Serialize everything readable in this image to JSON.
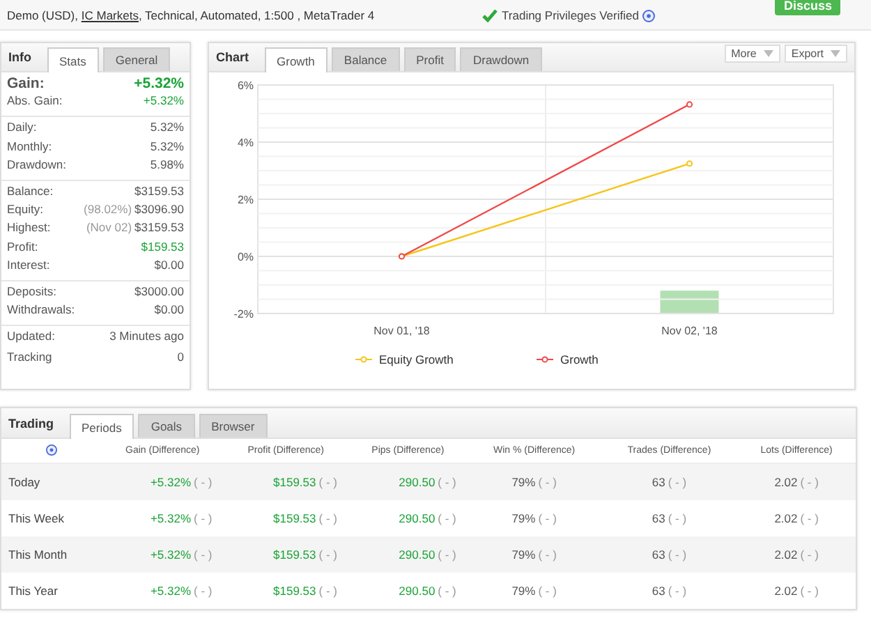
{
  "header": {
    "subtitle_parts": [
      {
        "text": "Demo (USD), ",
        "link": false
      },
      {
        "text": "IC Markets",
        "link": true
      },
      {
        "text": ", Technical, Automated, 1:500 , MetaTrader 4",
        "link": false
      }
    ],
    "verified": "Trading Privileges Verified",
    "discuss": "Discuss"
  },
  "info": {
    "title": "Info",
    "tabs": [
      {
        "label": "Stats",
        "selected": true
      },
      {
        "label": "General",
        "selected": false
      }
    ],
    "groups": [
      [
        {
          "label": "Gain:",
          "value": "+5.32%",
          "kind": "big",
          "positive": true
        },
        {
          "label": "Abs. Gain:",
          "value": "+5.32%",
          "kind": "plain",
          "positive": true
        }
      ],
      [
        {
          "label": "Daily:",
          "value": "5.32%",
          "kind": "plain",
          "positive": false
        },
        {
          "label": "Monthly:",
          "value": "5.32%",
          "kind": "plain",
          "positive": false
        },
        {
          "label": "Drawdown:",
          "value": "5.98%",
          "kind": "plain",
          "positive": false
        }
      ],
      [
        {
          "label": "Balance:",
          "value": "$3159.53",
          "kind": "plain",
          "positive": false
        },
        {
          "label": "Equity:",
          "note": "(98.02%)",
          "value": "$3096.90",
          "kind": "plain",
          "positive": false
        },
        {
          "label": "Highest:",
          "note": "(Nov 02)",
          "value": "$3159.53",
          "kind": "plain",
          "positive": false
        },
        {
          "label": "Profit:",
          "value": "$159.53",
          "kind": "plain",
          "positive": true
        },
        {
          "label": "Interest:",
          "value": "$0.00",
          "kind": "plain",
          "positive": false
        }
      ],
      [
        {
          "label": "Deposits:",
          "value": "$3000.00",
          "kind": "plain",
          "positive": false
        },
        {
          "label": "Withdrawals:",
          "value": "$0.00",
          "kind": "plain",
          "positive": false
        }
      ],
      [
        {
          "label": "Updated:",
          "value": "3 Minutes ago",
          "kind": "tall",
          "positive": false
        },
        {
          "label": "Tracking",
          "value": "0",
          "kind": "tall",
          "positive": false
        }
      ]
    ]
  },
  "chart": {
    "title": "Chart",
    "tabs": [
      {
        "label": "Growth",
        "selected": true
      },
      {
        "label": "Balance",
        "selected": false
      },
      {
        "label": "Profit",
        "selected": false
      },
      {
        "label": "Drawdown",
        "selected": false
      }
    ],
    "menus": [
      "More",
      "Export"
    ],
    "chart_data": {
      "type": "line",
      "grid": true,
      "legend": "bottom",
      "categories": [
        "Nov 01, '18",
        "Nov 02, '18"
      ],
      "ylim": [
        -2,
        6
      ],
      "yticks": [
        {
          "value": -2,
          "label": "-2%"
        },
        {
          "value": 0,
          "label": "0%"
        },
        {
          "value": 2,
          "label": "2%"
        },
        {
          "value": 4,
          "label": "4%"
        },
        {
          "value": 6,
          "label": "6%"
        }
      ],
      "series": [
        {
          "name": "Equity Growth",
          "color": "#f5c518",
          "marker": "o",
          "values": [
            0,
            3.25
          ]
        },
        {
          "name": "Growth",
          "color": "#f04848",
          "marker": "o",
          "values": [
            0,
            5.32
          ]
        }
      ]
    }
  },
  "trading": {
    "title": "Trading",
    "tabs": [
      {
        "label": "Periods",
        "selected": true
      },
      {
        "label": "Goals",
        "selected": false
      },
      {
        "label": "Browser",
        "selected": false
      }
    ],
    "columns": [
      "Gain (Difference)",
      "Profit (Difference)",
      "Pips (Difference)",
      "Win % (Difference)",
      "Trades (Difference)",
      "Lots (Difference)"
    ],
    "rows": [
      {
        "period": "Today",
        "cells": [
          {
            "value": "+5.32%",
            "diff": "( - )",
            "positive": true
          },
          {
            "value": "$159.53",
            "diff": "( - )",
            "positive": true
          },
          {
            "value": "290.50",
            "diff": "( - )",
            "positive": true
          },
          {
            "value": "79%",
            "diff": "( - )",
            "positive": false
          },
          {
            "value": "63",
            "diff": "( - )",
            "positive": false
          },
          {
            "value": "2.02",
            "diff": "( - )",
            "positive": false
          }
        ]
      },
      {
        "period": "This Week",
        "cells": [
          {
            "value": "+5.32%",
            "diff": "( - )",
            "positive": true
          },
          {
            "value": "$159.53",
            "diff": "( - )",
            "positive": true
          },
          {
            "value": "290.50",
            "diff": "( - )",
            "positive": true
          },
          {
            "value": "79%",
            "diff": "( - )",
            "positive": false
          },
          {
            "value": "63",
            "diff": "( - )",
            "positive": false
          },
          {
            "value": "2.02",
            "diff": "( - )",
            "positive": false
          }
        ]
      },
      {
        "period": "This Month",
        "cells": [
          {
            "value": "+5.32%",
            "diff": "( - )",
            "positive": true
          },
          {
            "value": "$159.53",
            "diff": "( - )",
            "positive": true
          },
          {
            "value": "290.50",
            "diff": "( - )",
            "positive": true
          },
          {
            "value": "79%",
            "diff": "( - )",
            "positive": false
          },
          {
            "value": "63",
            "diff": "( - )",
            "positive": false
          },
          {
            "value": "2.02",
            "diff": "( - )",
            "positive": false
          }
        ]
      },
      {
        "period": "This Year",
        "cells": [
          {
            "value": "+5.32%",
            "diff": "( - )",
            "positive": true
          },
          {
            "value": "$159.53",
            "diff": "( - )",
            "positive": true
          },
          {
            "value": "290.50",
            "diff": "( - )",
            "positive": true
          },
          {
            "value": "79%",
            "diff": "( - )",
            "positive": false
          },
          {
            "value": "63",
            "diff": "( - )",
            "positive": false
          },
          {
            "value": "2.02",
            "diff": "( - )",
            "positive": false
          }
        ]
      }
    ]
  }
}
